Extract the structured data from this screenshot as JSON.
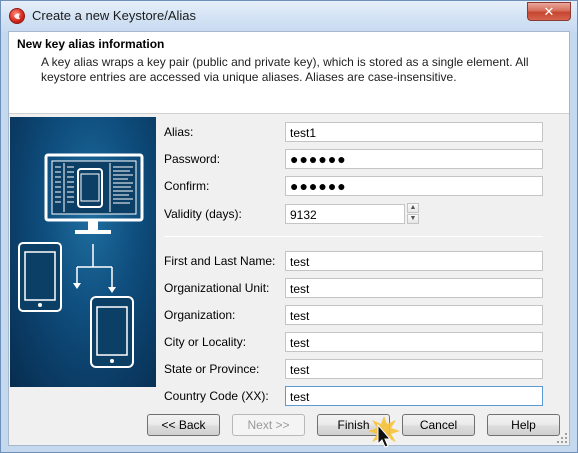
{
  "window": {
    "title": "Create a new Keystore/Alias",
    "close_glyph": "✕"
  },
  "header": {
    "title": "New key alias information",
    "description": "A key alias wraps a key pair (public and private key), which is stored as a single element. All keystore entries are accessed via unique aliases. Aliases are case-insensitive."
  },
  "form": {
    "alias": {
      "label": "Alias:",
      "value": "test1"
    },
    "password": {
      "label": "Password:",
      "value": "●●●●●●"
    },
    "confirm": {
      "label": "Confirm:",
      "value": "●●●●●●"
    },
    "validity": {
      "label": "Validity (days):",
      "value": "9132",
      "up_glyph": "▲",
      "down_glyph": "▼"
    },
    "first_last_name": {
      "label": "First and Last Name:",
      "value": "test"
    },
    "org_unit": {
      "label": "Organizational Unit:",
      "value": "test"
    },
    "organization": {
      "label": "Organization:",
      "value": "test"
    },
    "city": {
      "label": "City or Locality:",
      "value": "test"
    },
    "state": {
      "label": "State or Province:",
      "value": "test"
    },
    "country": {
      "label": "Country Code (XX):",
      "value": "test"
    }
  },
  "buttons": {
    "back": "<< Back",
    "next": "Next >>",
    "finish": "Finish",
    "cancel": "Cancel",
    "help": "Help"
  },
  "icons": {
    "app": "app-logo-icon",
    "illustration": "devices-illustration",
    "cursor": "mouse-cursor-icon"
  },
  "colors": {
    "illustration_bg": "#0f4f7f",
    "focus_border": "#5b9bd5",
    "close_button": "#c7452f"
  }
}
